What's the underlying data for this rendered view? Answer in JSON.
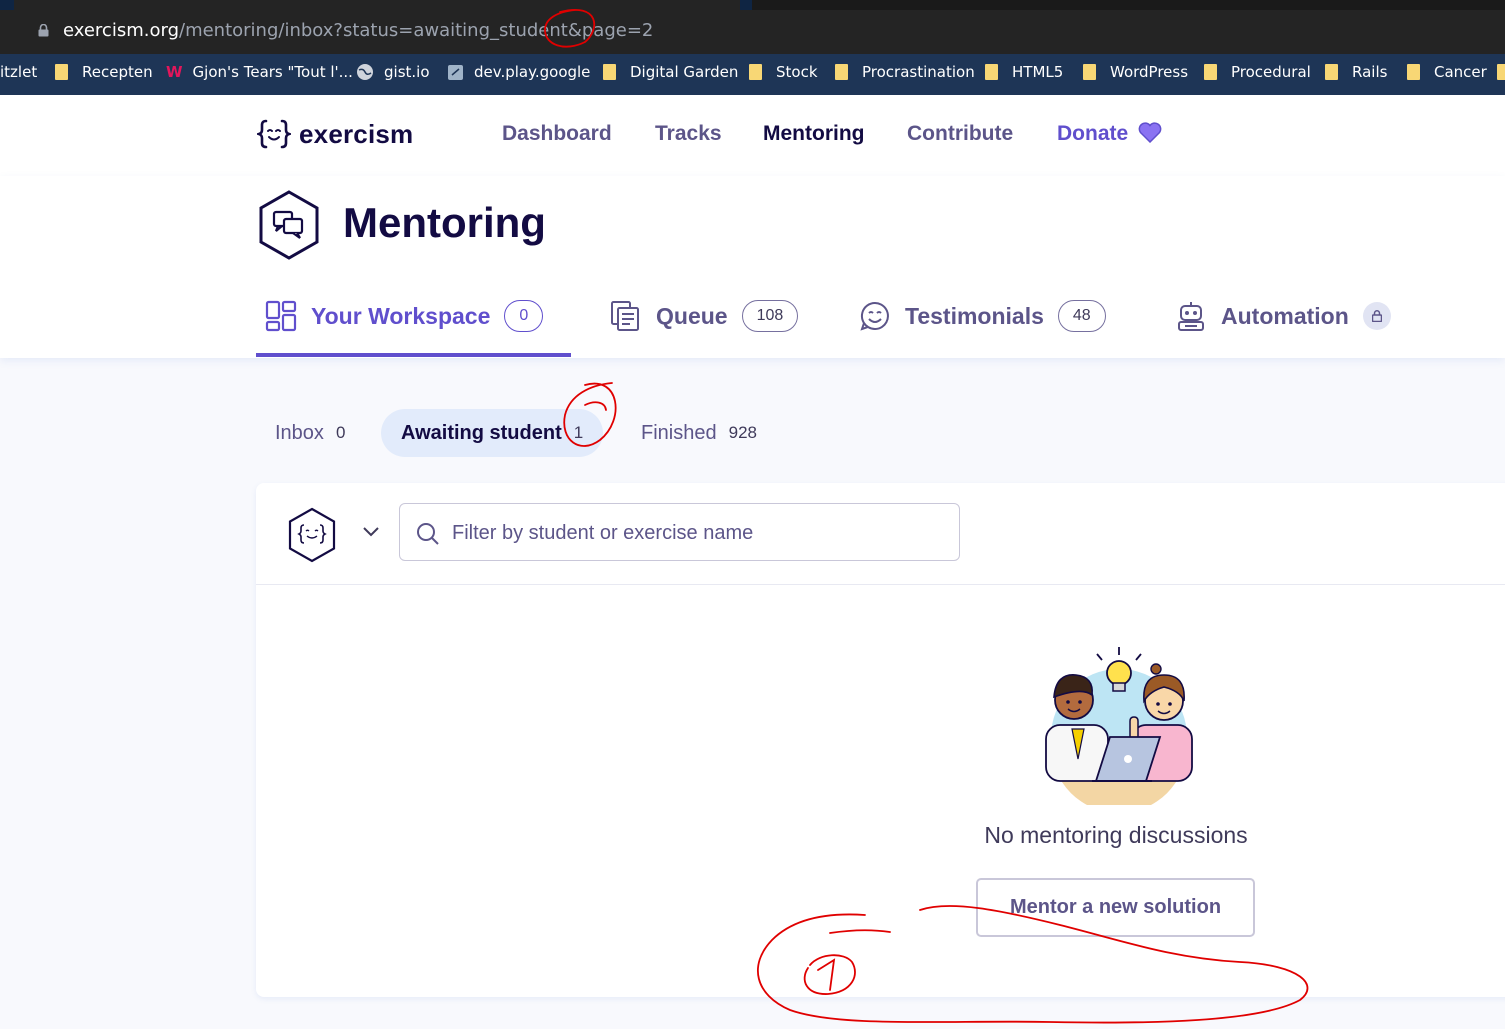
{
  "browser": {
    "url_domain": "exercism.org",
    "url_path": "/mentoring/inbox?status=awaiting_student&page=2",
    "bookmarks": [
      "itzlet",
      "Recepten",
      "Gjon's Tears \"Tout l'...",
      "gist.io",
      "dev.play.google",
      "Digital Garden",
      "Stock",
      "Procrastination",
      "HTML5",
      "WordPress",
      "Procedural",
      "Rails",
      "Cancer"
    ]
  },
  "nav": {
    "logo": "exercism",
    "links": [
      "Dashboard",
      "Tracks",
      "Mentoring",
      "Contribute",
      "Donate"
    ]
  },
  "page": {
    "title": "Mentoring"
  },
  "workspace_tabs": [
    {
      "label": "Your Workspace",
      "count": "0"
    },
    {
      "label": "Queue",
      "count": "108"
    },
    {
      "label": "Testimonials",
      "count": "48"
    },
    {
      "label": "Automation"
    }
  ],
  "sub_tabs": [
    {
      "label": "Inbox",
      "count": "0"
    },
    {
      "label": "Awaiting student",
      "count": "1"
    },
    {
      "label": "Finished",
      "count": "928"
    }
  ],
  "filter": {
    "placeholder": "Filter by student or exercise name"
  },
  "empty_state": {
    "message": "No mentoring discussions",
    "button": "Mentor a new solution"
  },
  "colors": {
    "brand_purple": "#604fcd",
    "dark_text": "#130b43",
    "annotation_red": "#e00000"
  }
}
